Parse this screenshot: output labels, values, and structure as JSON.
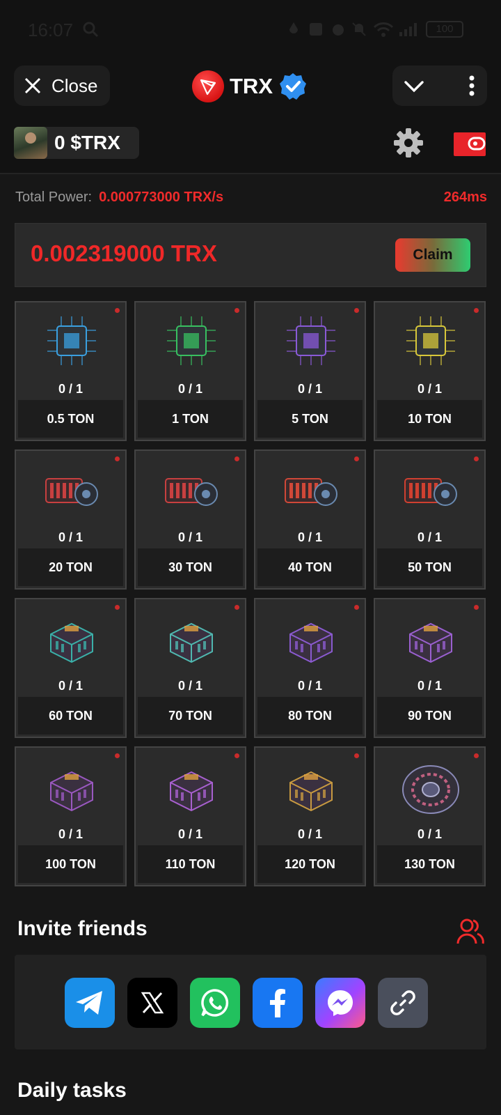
{
  "status_bar": {
    "time": "16:07",
    "battery": "100"
  },
  "header": {
    "close_label": "Close",
    "title": "TRX"
  },
  "user": {
    "balance": "0 $TRX"
  },
  "power": {
    "label": "Total Power:",
    "value": "0.000773000 TRX/s",
    "ping": "264ms"
  },
  "claim": {
    "amount": "0.002319000 TRX",
    "button_label": "Claim"
  },
  "miners": [
    {
      "count": "0 / 1",
      "price": "0.5 TON",
      "icon": "blue-chip-icon",
      "color": "#3aa0e0"
    },
    {
      "count": "0 / 1",
      "price": "1 TON",
      "icon": "green-chip-icon",
      "color": "#38c060"
    },
    {
      "count": "0 / 1",
      "price": "5 TON",
      "icon": "purple-chip-icon",
      "color": "#8a5ad8"
    },
    {
      "count": "0 / 1",
      "price": "10 TON",
      "icon": "yellow-chip-icon",
      "color": "#d8c83a"
    },
    {
      "count": "0 / 1",
      "price": "20 TON",
      "icon": "red-miner-icon",
      "color": "#c84040"
    },
    {
      "count": "0 / 1",
      "price": "30 TON",
      "icon": "red-miner-icon",
      "color": "#c84040"
    },
    {
      "count": "0 / 1",
      "price": "40 TON",
      "icon": "red-miner-icon",
      "color": "#d04838"
    },
    {
      "count": "0 / 1",
      "price": "50 TON",
      "icon": "red-rig-icon",
      "color": "#d04030"
    },
    {
      "count": "0 / 1",
      "price": "60 TON",
      "icon": "teal-generator-icon",
      "color": "#3ab0a8"
    },
    {
      "count": "0 / 1",
      "price": "70 TON",
      "icon": "teal-server-icon",
      "color": "#50b8b0"
    },
    {
      "count": "0 / 1",
      "price": "80 TON",
      "icon": "purple-platform-icon",
      "color": "#8a5ad0"
    },
    {
      "count": "0 / 1",
      "price": "90 TON",
      "icon": "purple-stack-icon",
      "color": "#9a60d0"
    },
    {
      "count": "0 / 1",
      "price": "100 TON",
      "icon": "purple-machine-icon",
      "color": "#9a58c0"
    },
    {
      "count": "0 / 1",
      "price": "110 TON",
      "icon": "purple-frame-icon",
      "color": "#a860d0"
    },
    {
      "count": "0 / 1",
      "price": "120 TON",
      "icon": "gold-turbine-icon",
      "color": "#c89a40"
    },
    {
      "count": "0 / 1",
      "price": "130 TON",
      "icon": "reactor-disc-icon",
      "color": "#8a8ab8"
    }
  ],
  "invite": {
    "title": "Invite friends"
  },
  "share": [
    {
      "name": "telegram-share-button",
      "icon": "telegram-icon",
      "color": "#1a8fe8"
    },
    {
      "name": "x-share-button",
      "icon": "x-icon",
      "color": "#000000"
    },
    {
      "name": "whatsapp-share-button",
      "icon": "whatsapp-icon",
      "color": "#22c15e"
    },
    {
      "name": "facebook-share-button",
      "icon": "facebook-icon",
      "color": "#1877f2"
    },
    {
      "name": "messenger-share-button",
      "icon": "messenger-icon",
      "color": "#a044ff"
    },
    {
      "name": "copy-link-button",
      "icon": "link-icon",
      "color": "#4a4f5c"
    }
  ],
  "daily": {
    "title": "Daily tasks"
  },
  "colors": {
    "accent_red": "#f02b2b",
    "background": "#171717"
  }
}
